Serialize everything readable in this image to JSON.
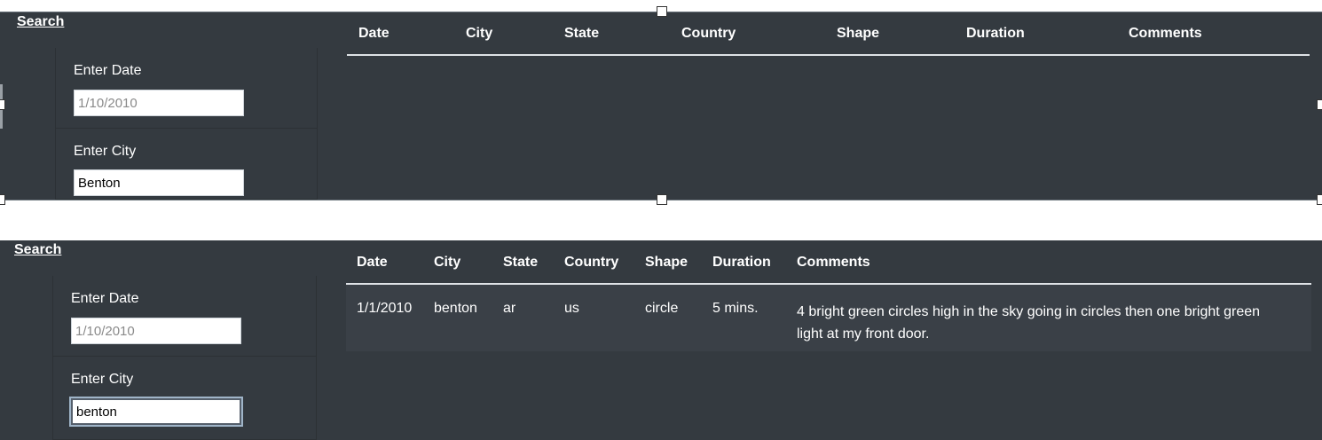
{
  "top_panel": {
    "search_label": "Search",
    "filters": [
      {
        "label": "Enter Date",
        "value": "",
        "placeholder": "1/10/2010"
      },
      {
        "label": "Enter City",
        "value": "Benton",
        "placeholder": ""
      }
    ],
    "table": {
      "headers": [
        "Date",
        "City",
        "State",
        "Country",
        "Shape",
        "Duration",
        "Comments"
      ],
      "rows": []
    }
  },
  "bottom_panel": {
    "search_label": "Search",
    "filters": [
      {
        "label": "Enter Date",
        "value": "",
        "placeholder": "1/10/2010"
      },
      {
        "label": "Enter City",
        "value": "benton",
        "placeholder": ""
      }
    ],
    "table": {
      "headers": [
        "Date",
        "City",
        "State",
        "Country",
        "Shape",
        "Duration",
        "Comments"
      ],
      "rows": [
        {
          "date": "1/1/2010",
          "city": "benton",
          "state": "ar",
          "country": "us",
          "shape": "circle",
          "duration": "5 mins.",
          "comments_line1": "4 bright green circles high in the sky going in circles then one bright green",
          "comments_line2": "light at my front door."
        }
      ]
    }
  },
  "colors": {
    "panel_bg": "#343a40",
    "page_bg": "#ffffff",
    "text": "#ffffff",
    "input_bg": "#ffffff",
    "focus_ring": "#9fb4c8"
  }
}
